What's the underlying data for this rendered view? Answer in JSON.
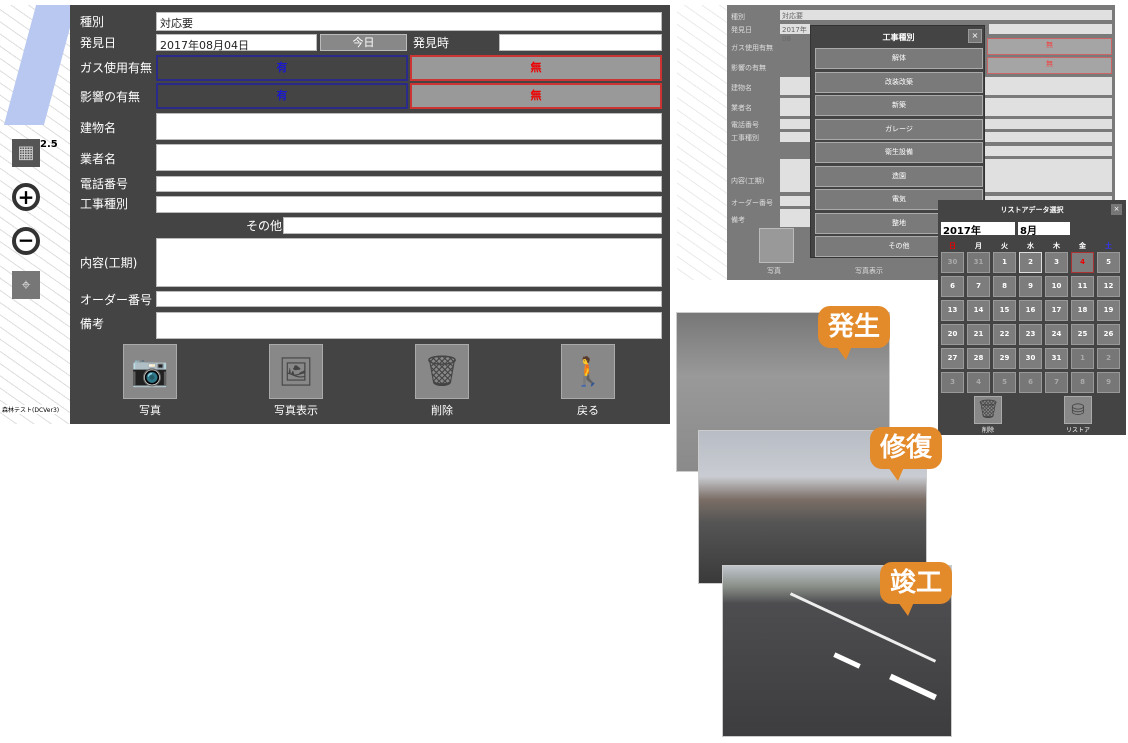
{
  "map": {
    "scale_label": "2.5",
    "attribution": "森林テスト(DCVer3)"
  },
  "form": {
    "type_label": "種別",
    "type_value": "対応要",
    "date_label": "発見日",
    "date_value": "2017年08月04日",
    "today_button": "今日",
    "time_label": "発見時",
    "time_value": "",
    "gas_label": "ガス使用有無",
    "gas_yes": "有",
    "gas_no": "無",
    "impact_label": "影響の有無",
    "impact_yes": "有",
    "impact_no": "無",
    "building_label": "建物名",
    "vendor_label": "業者名",
    "phone_label": "電話番号",
    "work_type_label": "工事種別",
    "other_label": "その他",
    "content_label": "内容(工期)",
    "order_label": "オーダー番号",
    "notes_label": "備考",
    "buttons": {
      "photo": "写真",
      "photo_view": "写真表示",
      "delete": "削除",
      "back": "戻る"
    }
  },
  "dim_form": {
    "labels": [
      "種別",
      "発見日",
      "ガス使用有無",
      "影響の有無",
      "建物名",
      "業者名",
      "電話番号",
      "工事種別",
      "内容(工期)",
      "オーダー番号",
      "備考"
    ],
    "type_value": "対応要",
    "date_value": "2017年08",
    "no": "無",
    "photo": "写真",
    "photo_view": "写真表示"
  },
  "work_type_popup": {
    "title": "工事種別",
    "close": "×",
    "items": [
      "解体",
      "改装改築",
      "新築",
      "ガレージ",
      "衛生設備",
      "造園",
      "電気",
      "整地",
      "その他"
    ]
  },
  "calendar": {
    "title": "リストアデータ選択",
    "close": "×",
    "year": "2017年",
    "month": "8月",
    "weekdays": [
      "日",
      "月",
      "火",
      "水",
      "木",
      "金",
      "土"
    ],
    "weeks": [
      [
        "30",
        "31",
        "1",
        "2",
        "3",
        "4",
        "5"
      ],
      [
        "6",
        "7",
        "8",
        "9",
        "10",
        "11",
        "12"
      ],
      [
        "13",
        "14",
        "15",
        "16",
        "17",
        "18",
        "19"
      ],
      [
        "20",
        "21",
        "22",
        "23",
        "24",
        "25",
        "26"
      ],
      [
        "27",
        "28",
        "29",
        "30",
        "31",
        "1",
        "2"
      ],
      [
        "3",
        "4",
        "5",
        "6",
        "7",
        "8",
        "9"
      ]
    ],
    "selected": "4",
    "delete": "削除",
    "restore": "リストア"
  },
  "photos": {
    "stage1": "発生",
    "stage2": "修復",
    "stage3": "竣工"
  },
  "colors": {
    "panel": "#444444",
    "yes": "#1a1acc",
    "no": "#ee0000",
    "bubble": "#e38a2b"
  }
}
